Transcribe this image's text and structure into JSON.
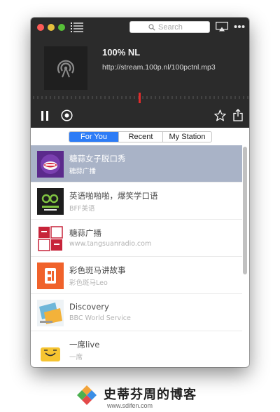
{
  "search": {
    "placeholder": "Search"
  },
  "now_playing": {
    "title": "100% NL",
    "url": "http://stream.100p.nl/100pctnl.mp3"
  },
  "tabs": [
    {
      "label": "For You",
      "active": true
    },
    {
      "label": "Recent",
      "active": false
    },
    {
      "label": "My Station",
      "active": false
    }
  ],
  "stations": [
    {
      "name": "糖蒜女子脱口秀",
      "subtitle": "糖蒜广播",
      "selected": true
    },
    {
      "name": "英语啪啪啪，爆笑学口语",
      "subtitle": "BFF美语",
      "selected": false
    },
    {
      "name": "糖蒜广播",
      "subtitle": "www.tangsuanradio.com",
      "selected": false
    },
    {
      "name": "彩色斑马讲故事",
      "subtitle": "彩色斑马Leo",
      "selected": false
    },
    {
      "name": "Discovery",
      "subtitle": "BBC World Service",
      "selected": false
    },
    {
      "name": "一席live",
      "subtitle": "一席",
      "selected": false
    }
  ],
  "watermark": {
    "name": "史蒂芬周的博客",
    "url": "www.sdifen.com"
  },
  "colors": {
    "player_bg": "#2b2b2b",
    "accent": "#2d7cf6",
    "selected_row": "#a9b3c7",
    "progress_marker": "#e02b2b"
  }
}
